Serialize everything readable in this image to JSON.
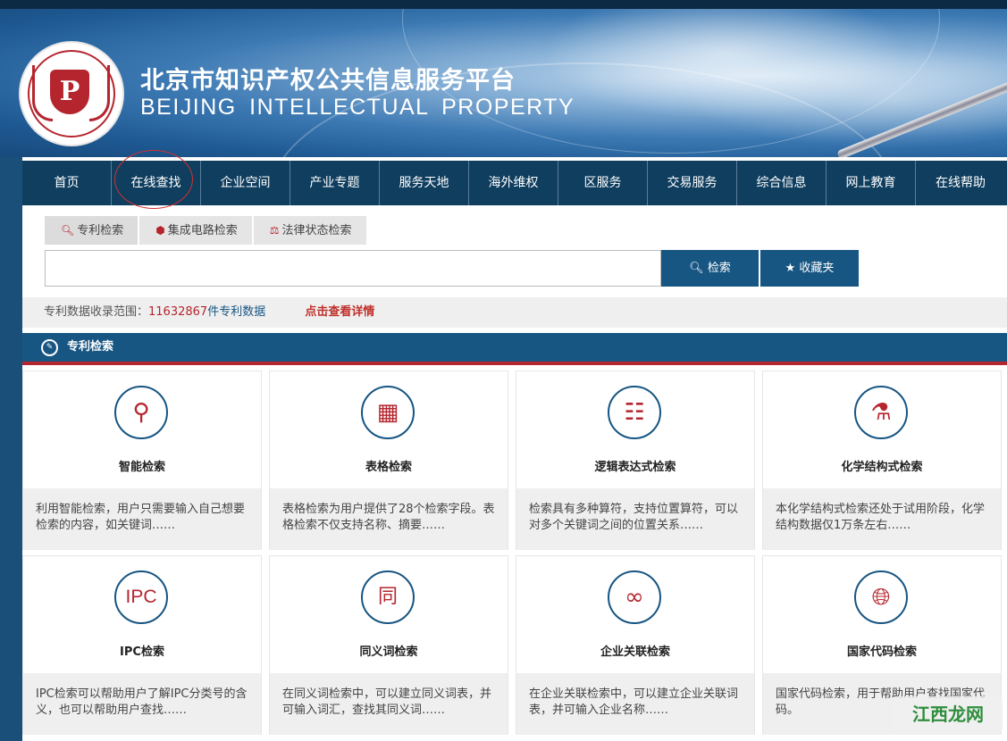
{
  "header": {
    "title_cn": "北京市知识产权公共信息服务平台",
    "title_en": "BEIJING INTELLECTUAL PROPERTY",
    "logo_letter": "P"
  },
  "nav": {
    "items": [
      "首页",
      "在线查找",
      "企业空间",
      "产业专题",
      "服务天地",
      "海外维权",
      "区服务",
      "交易服务",
      "综合信息",
      "网上教育",
      "在线帮助"
    ],
    "active_index": 1
  },
  "search": {
    "tabs": [
      {
        "label": "专利检索",
        "icon": "search-icon"
      },
      {
        "label": "集成电路检索",
        "icon": "chip-icon"
      },
      {
        "label": "法律状态检索",
        "icon": "scales-icon"
      }
    ],
    "input_value": "",
    "search_button": "检索",
    "favorites_button": "收藏夹"
  },
  "range": {
    "label": "专利数据收录范围：",
    "count": "11632867",
    "unit": "件专利数据",
    "detail_link": "点击查看详情"
  },
  "section": {
    "title": "专利检索"
  },
  "cards": [
    {
      "name": "智能检索",
      "icon": "magnifier-icon",
      "desc": "利用智能检索，用户只需要输入自己想要检索的内容，如关键词……"
    },
    {
      "name": "表格检索",
      "icon": "table-icon",
      "desc": "表格检索为用户提供了28个检索字段。表格检索不仅支持名称、摘要……"
    },
    {
      "name": "逻辑表达式检索",
      "icon": "hierarchy-icon",
      "desc": "检索具有多种算符，支持位置算符，可以对多个关键词之间的位置关系……"
    },
    {
      "name": "化学结构式检索",
      "icon": "flask-icon",
      "desc": "本化学结构式检索还处于试用阶段，化学结构数据仅1万条左右……"
    },
    {
      "name": "IPC检索",
      "icon": "ipc-icon",
      "icon_text": "IPC",
      "desc": "IPC检索可以帮助用户了解IPC分类号的含义，也可以帮助用户查找……"
    },
    {
      "name": "同义词检索",
      "icon": "synonym-icon",
      "icon_text": "同",
      "desc": "在同义词检索中，可以建立同义词表，并可输入词汇，查找其同义词……"
    },
    {
      "name": "企业关联检索",
      "icon": "link-icon",
      "desc": "在企业关联检索中，可以建立企业关联词表，并可输入企业名称……"
    },
    {
      "name": "国家代码检索",
      "icon": "globe-icon",
      "desc": "国家代码检索，用于帮助用户查找国家代码。"
    }
  ],
  "watermark": "江西龙网",
  "colors": {
    "nav_bg": "#0f3e5f",
    "primary": "#175582",
    "accent_red": "#b5252e"
  }
}
